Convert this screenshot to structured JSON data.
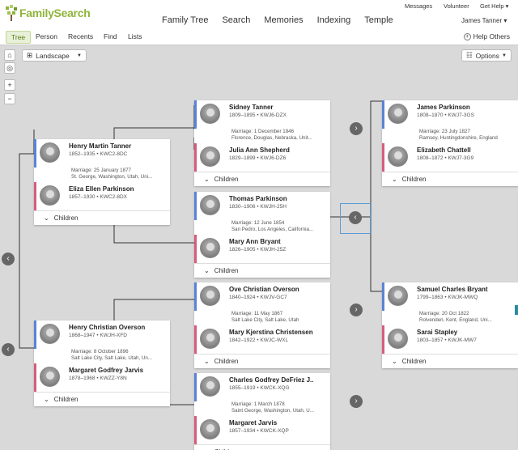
{
  "header": {
    "logo": "FamilySearch",
    "nav": [
      "Family Tree",
      "Search",
      "Memories",
      "Indexing",
      "Temple"
    ],
    "messages": "Messages",
    "volunteer": "Volunteer",
    "get_help": "Get Help ▾",
    "user": "James Tanner ▾"
  },
  "subnav": {
    "tabs": [
      "Tree",
      "Person",
      "Recents",
      "Find",
      "Lists"
    ],
    "help": "Help Others"
  },
  "toolbar": {
    "view": "Landscape",
    "options": "Options"
  },
  "colors": {
    "male": "#5b82d6",
    "female": "#d85b7d",
    "brand": "#8fb43a"
  },
  "children_label": "Children",
  "couples": [
    {
      "h": {
        "name": "Henry Martin Tanner",
        "dates": "1852–1935 • KWC2-8DC"
      },
      "m": [
        "Marriage: 25 January 1877",
        "St. George, Washington, Utah, Uni..."
      ],
      "w": {
        "name": "Eliza Ellen Parkinson",
        "dates": "1857–1930 • KWC2-8DX"
      }
    },
    {
      "h": {
        "name": "Henry Christian Overson",
        "dates": "1868–1947 • KWJH-XFD"
      },
      "m": [
        "Marriage: 8 October 1896",
        "Salt Lake City, Salt Lake, Utah, Un..."
      ],
      "w": {
        "name": "Margaret Godfrey Jarvis",
        "dates": "1878–1968 • KWZZ-Y8N"
      }
    },
    {
      "h": {
        "name": "Sidney Tanner",
        "dates": "1809–1895 • KWJ6-DZX"
      },
      "m": [
        "Marriage: 1 December 1846",
        "Florence, Douglas, Nebraska, Unit..."
      ],
      "w": {
        "name": "Julia Ann Shepherd",
        "dates": "1829–1899 • KWJ6-DZ6"
      }
    },
    {
      "h": {
        "name": "Thomas Parkinson",
        "dates": "1830–1906 • KWJH-25H"
      },
      "m": [
        "Marriage: 12 June 1854",
        "San Pedro, Los Angeles, California..."
      ],
      "w": {
        "name": "Mary Ann Bryant",
        "dates": "1826–1905 • KWJH-25Z"
      }
    },
    {
      "h": {
        "name": "Ove Christian Overson",
        "dates": "1840–1924 • KWJV-GC7"
      },
      "m": [
        "Marriage: 11 May 1867",
        "Salt Lake City, Salt Lake, Utah"
      ],
      "w": {
        "name": "Mary Kjerstina Christensen",
        "dates": "1842–1922 • KWJC-WXL"
      }
    },
    {
      "h": {
        "name": "Charles Godfrey DeFriez J..",
        "dates": "1855–1919 • KWCK-XQG"
      },
      "m": [
        "Marriage: 1 March 1878",
        "Saint George, Washington, Utah, U..."
      ],
      "w": {
        "name": "Margaret Jarvis",
        "dates": "1857–1934 • KWCK-XQP"
      }
    },
    {
      "h": {
        "name": "James Parkinson",
        "dates": "1808–1870 • KWJ7-3GS"
      },
      "m": [
        "Marriage: 23 July 1827",
        "Ramsey, Huntingdonshire, England"
      ],
      "w": {
        "name": "Elizabeth Chattell",
        "dates": "1808–1872 • KWJ7-3G9"
      }
    },
    {
      "h": {
        "name": "Samuel Charles Bryant",
        "dates": "1799–1863 • KWJK-MWQ"
      },
      "m": [
        "Marriage: 20 Oct 1822",
        "Rolvenden, Kent, England, Uni..."
      ],
      "w": {
        "name": "Sarai Stapley",
        "dates": "1803–1857 • KWJK-MW7"
      }
    }
  ]
}
